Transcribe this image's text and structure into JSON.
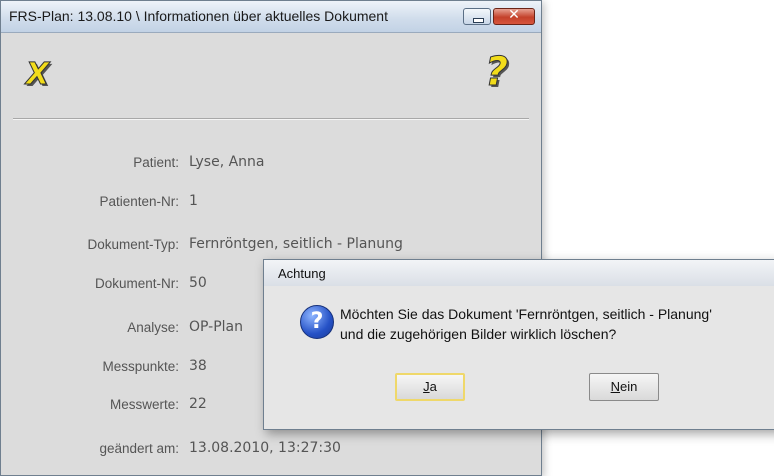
{
  "window": {
    "title": "FRS-Plan: 13.08.10 \\ Informationen über aktuelles Dokument"
  },
  "toolbar": {
    "close_icon": "yellow-x-icon",
    "help_icon": "yellow-question-icon"
  },
  "fields": {
    "patient": {
      "label": "Patient:",
      "value": "Lyse, Anna"
    },
    "patient_nr": {
      "label": "Patienten-Nr:",
      "value": "1"
    },
    "dokument_typ": {
      "label": "Dokument-Typ:",
      "value": "Fernröntgen, seitlich - Planung"
    },
    "dokument_nr": {
      "label": "Dokument-Nr:",
      "value": "50"
    },
    "analyse": {
      "label": "Analyse:",
      "value": "OP-Plan"
    },
    "messpunkte": {
      "label": "Messpunkte:",
      "value": "38"
    },
    "messwerte": {
      "label": "Messwerte:",
      "value": "22"
    },
    "geaendert": {
      "label": "geändert am:",
      "value": "13.08.2010, 13:27:30"
    }
  },
  "dialog": {
    "title": "Achtung",
    "message_line1": "Möchten Sie das Dokument 'Fernröntgen, seitlich - Planung'",
    "message_line2": "und die zugehörigen Bilder wirklich löschen?",
    "yes_mnemonic": "J",
    "yes_rest": "a",
    "no_mnemonic": "N",
    "no_rest": "ein",
    "icon": "question-icon"
  },
  "colors": {
    "window_bg": "#dcdcdc",
    "accent_yellow": "#f2dc1a",
    "close_red": "#c4412b"
  }
}
